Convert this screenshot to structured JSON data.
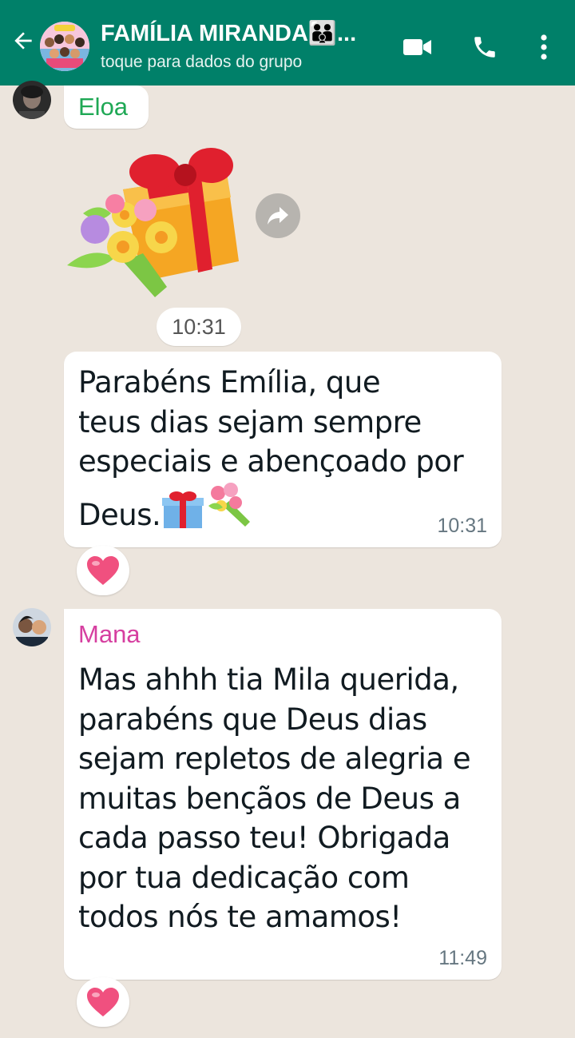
{
  "header": {
    "title": "FAMÍLIA MIRANDA👪...",
    "subtitle": "toque para dados do grupo",
    "icons": [
      "back-arrow-icon",
      "video-call-icon",
      "phone-icon",
      "more-vert-icon"
    ],
    "color": "#008069"
  },
  "messages": [
    {
      "sender": "Eloa",
      "sender_color": "#1FA855",
      "type": "sticker",
      "sticker": "gift-with-flowers",
      "time": "10:31"
    },
    {
      "sender": "Eloa",
      "type": "text",
      "text_lines": [
        "Parabéns Emília, que",
        "teus dias sejam sempre",
        "especiais e abençoado por",
        "Deus."
      ],
      "trailing_emoji": [
        "gift-icon",
        "bouquet-icon"
      ],
      "time": "10:31",
      "reaction": "heart"
    },
    {
      "sender": "Mana",
      "sender_color": "#D63FA0",
      "type": "text",
      "text_lines": [
        "Mas ahhh tia Mila querida,",
        "parabéns que Deus dias",
        "sejam repletos de alegria e",
        "muitas bençãos de Deus a",
        "cada passo teu! Obrigada",
        "por tua dedicação com",
        "todos nós te amamos!"
      ],
      "time": "11:49",
      "reaction": "heart"
    }
  ]
}
